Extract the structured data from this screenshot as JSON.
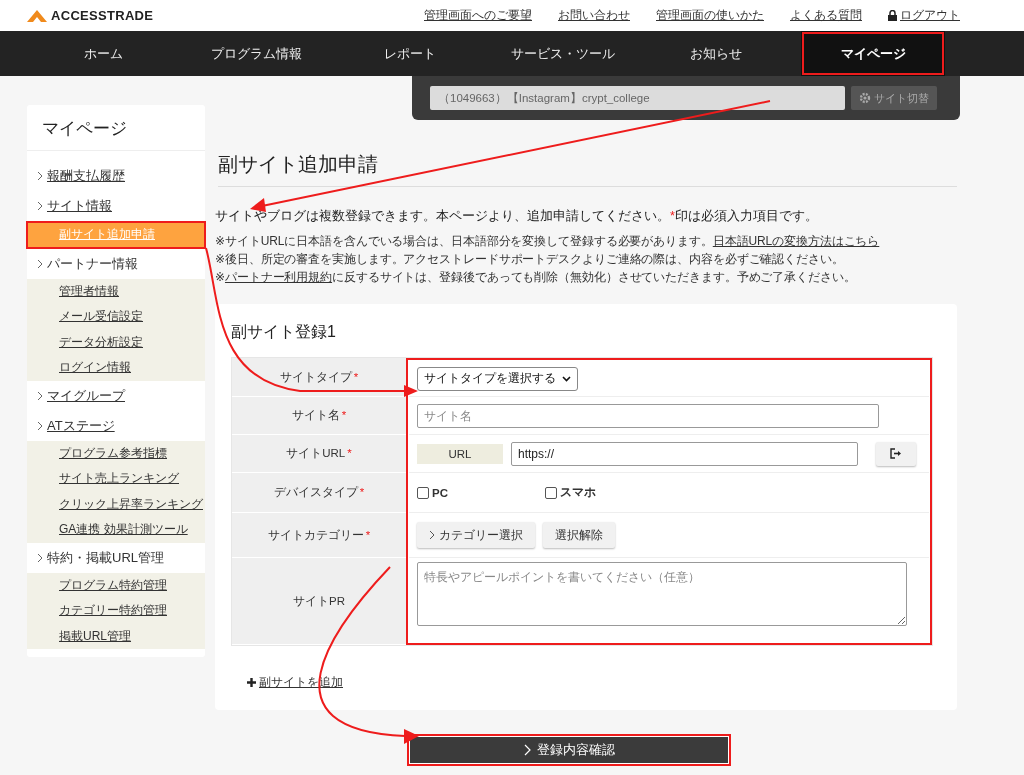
{
  "header": {
    "logo": "ACCESSTRADE",
    "links": [
      {
        "label": "管理画面へのご要望"
      },
      {
        "label": "お問い合わせ"
      },
      {
        "label": "管理画面の使いかた"
      },
      {
        "label": "よくある質問"
      }
    ],
    "logout": "ログアウト"
  },
  "nav": {
    "items": [
      {
        "label": "ホーム",
        "selected": false,
        "highlighted": false
      },
      {
        "label": "プログラム情報",
        "selected": false,
        "highlighted": false
      },
      {
        "label": "レポート",
        "selected": false,
        "highlighted": false
      },
      {
        "label": "サービス・ツール",
        "selected": false,
        "highlighted": false
      },
      {
        "label": "お知らせ",
        "selected": false,
        "highlighted": false
      },
      {
        "label": "マイページ",
        "selected": true,
        "highlighted": true
      }
    ]
  },
  "site_switcher": {
    "value": "（1049663）【Instagram】crypt_college",
    "button": "サイト切替"
  },
  "sidebar": {
    "title": "マイページ",
    "items": [
      {
        "label": "報酬支払履歴",
        "kind": "link"
      },
      {
        "label": "サイト情報",
        "kind": "link",
        "children": [
          {
            "label": "副サイト追加申請",
            "selected": true,
            "highlighted": true
          }
        ]
      },
      {
        "label": "パートナー情報",
        "kind": "group",
        "children": [
          {
            "label": "管理者情報",
            "selected": false,
            "highlighted": false
          },
          {
            "label": "メール受信設定",
            "selected": false,
            "highlighted": false
          },
          {
            "label": "データ分析設定",
            "selected": false,
            "highlighted": false
          },
          {
            "label": "ログイン情報",
            "selected": false,
            "highlighted": false
          }
        ]
      },
      {
        "label": "マイグループ",
        "kind": "link"
      },
      {
        "label": "ATステージ",
        "kind": "link",
        "children": [
          {
            "label": "プログラム参考指標",
            "selected": false,
            "highlighted": false
          },
          {
            "label": "サイト売上ランキング",
            "selected": false,
            "highlighted": false
          },
          {
            "label": "クリック上昇率ランキング",
            "selected": false,
            "highlighted": false
          },
          {
            "label": "GA連携 効果計測ツール",
            "selected": false,
            "highlighted": false
          }
        ]
      },
      {
        "label": "特約・掲載URL管理",
        "kind": "group",
        "children": [
          {
            "label": "プログラム特約管理",
            "selected": false,
            "highlighted": false
          },
          {
            "label": "カテゴリー特約管理",
            "selected": false,
            "highlighted": false
          },
          {
            "label": "掲載URL管理",
            "selected": false,
            "highlighted": false
          }
        ]
      }
    ]
  },
  "page": {
    "title": "副サイト追加申請",
    "intro": {
      "before": "サイトやブログは複数登録できます。本ページより、追加申請してください。",
      "mark": "*",
      "after": "印は必須入力項目です。"
    },
    "notes": [
      {
        "parts": [
          {
            "kind": "text",
            "text": "※サイトURLに日本語を含んでいる場合は、日本語部分を変換して登録する必要があります。"
          },
          {
            "kind": "link",
            "text": "日本語URLの変換方法はこちら"
          }
        ]
      },
      {
        "parts": [
          {
            "kind": "text",
            "text": "※後日、所定の審査を実施します。アクセストレードサポートデスクよりご連絡の際は、内容を必ずご確認ください。"
          }
        ]
      },
      {
        "parts": [
          {
            "kind": "text",
            "text": "※"
          },
          {
            "kind": "link",
            "text": "パートナー利用規約"
          },
          {
            "kind": "text",
            "text": "に反するサイトは、登録後であっても削除（無効化）させていただきます。予めご了承ください。"
          }
        ]
      }
    ]
  },
  "form": {
    "title": "副サイト登録1",
    "required_mark": "*",
    "highlighted": true,
    "rows": [
      {
        "label": "サイトタイプ",
        "required": true,
        "kind": "select",
        "value": "サイトタイプを選択する"
      },
      {
        "label": "サイト名",
        "required": true,
        "kind": "text",
        "placeholder": "サイト名"
      },
      {
        "label": "サイトURL",
        "required": true,
        "kind": "url",
        "prefix": "URL",
        "value": "https://"
      },
      {
        "label": "デバイスタイプ",
        "required": true,
        "kind": "checkboxes",
        "options": [
          {
            "label": "PC",
            "checked": false
          },
          {
            "label": "スマホ",
            "checked": false
          }
        ]
      },
      {
        "label": "サイトカテゴリー",
        "required": true,
        "kind": "buttons",
        "buttons": [
          {
            "label": "カテゴリー選択",
            "chevron": true
          },
          {
            "label": "選択解除",
            "chevron": false
          }
        ]
      },
      {
        "label": "サイトPR",
        "required": false,
        "kind": "textarea",
        "placeholder": "特長やアピールポイントを書いてください（任意）"
      }
    ],
    "add_link": "副サイトを追加"
  },
  "submit": {
    "label": "登録内容確認",
    "highlighted": true
  }
}
